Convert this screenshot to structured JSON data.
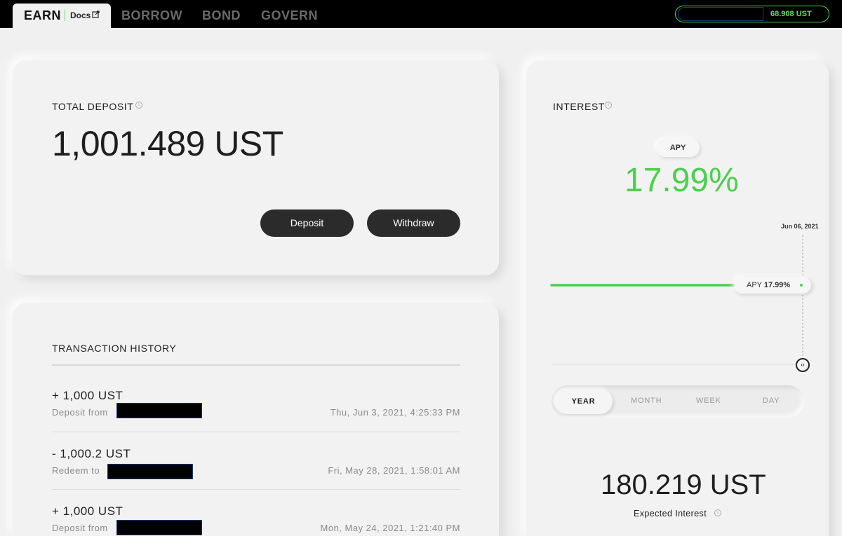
{
  "nav": {
    "active_tab": "EARN",
    "docs": "Docs",
    "tabs": [
      "BORROW",
      "BOND",
      "GOVERN"
    ]
  },
  "wallet": {
    "balance": "68.908 UST"
  },
  "deposit": {
    "label": "TOTAL DEPOSIT",
    "amount": "1,001.489 UST",
    "deposit_button": "Deposit",
    "withdraw_button": "Withdraw"
  },
  "history": {
    "title": "TRANSACTION HISTORY",
    "items": [
      {
        "amount": "+ 1,000 UST",
        "desc": "Deposit from",
        "date": "Thu, Jun 3, 2021, 4:25:33 PM"
      },
      {
        "amount": "- 1,000.2 UST",
        "desc": "Redeem to",
        "date": "Fri, May 28, 2021, 1:58:01 AM"
      },
      {
        "amount": "+ 1,000 UST",
        "desc": "Deposit from",
        "date": "Mon, May 24, 2021, 1:21:40 PM"
      }
    ]
  },
  "interest": {
    "label": "INTEREST",
    "apy_pill": "APY",
    "apy_value": "17.99%",
    "chart_date": "Jun 06, 2021",
    "tooltip_label": "APY",
    "tooltip_value": "17.99%",
    "handle": "‹›",
    "periods": [
      "YEAR",
      "MONTH",
      "WEEK",
      "DAY"
    ],
    "selected_period": "YEAR",
    "expected_amount": "180.219 UST",
    "expected_label": "Expected Interest"
  },
  "colors": {
    "accent_green": "#4bd04b",
    "dark_button": "#2b2b2b",
    "top_bar": "#000000"
  },
  "icons": {
    "info": "info-icon",
    "external_link": "external-link-icon"
  }
}
